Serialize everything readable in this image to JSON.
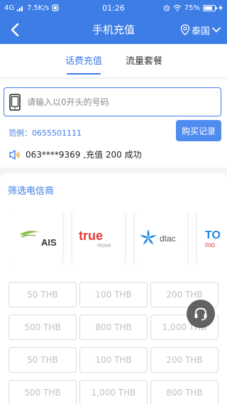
{
  "status_bar": {
    "network": "4G",
    "speed": "7.5K/s",
    "time": "01:26",
    "battery_text": "75%",
    "battery_level": 0.75
  },
  "nav": {
    "title": "手机充值",
    "region": "泰国"
  },
  "tabs": [
    {
      "label": "话费充值",
      "active": true
    },
    {
      "label": "流量套餐",
      "active": false
    }
  ],
  "phone_input": {
    "placeholder": "请输入以0开头的号码",
    "value": ""
  },
  "example": "范例：0655501111",
  "buy_record_label": "购买记录",
  "notice": "063****9369 ,充值 200 成功",
  "carrier_section": {
    "title": "筛选电信商",
    "carriers": [
      {
        "name": "AIS",
        "color": "#8bc34a"
      },
      {
        "name": "true",
        "sub": "move",
        "color": "#e53935"
      },
      {
        "name": "dtac",
        "color": "#1e88e5"
      },
      {
        "name": "TO",
        "sub": "mo",
        "color": "#1e88e5"
      }
    ]
  },
  "amounts": [
    "50 THB",
    "100 THB",
    "200 THB",
    "500 THB",
    "800 THB",
    "1,000 THB",
    "50 THB",
    "100 THB",
    "200 THB",
    "500 THB",
    "1,000 THB",
    "800 THB"
  ],
  "colors": {
    "primary": "#3d7de6",
    "button": "#4f8cf0"
  },
  "icons": {
    "back": "chevron-left-icon",
    "location": "location-pin-icon",
    "dropdown": "chevron-down-icon",
    "phone": "phone-icon",
    "speaker": "speaker-icon",
    "support": "headset-icon"
  }
}
